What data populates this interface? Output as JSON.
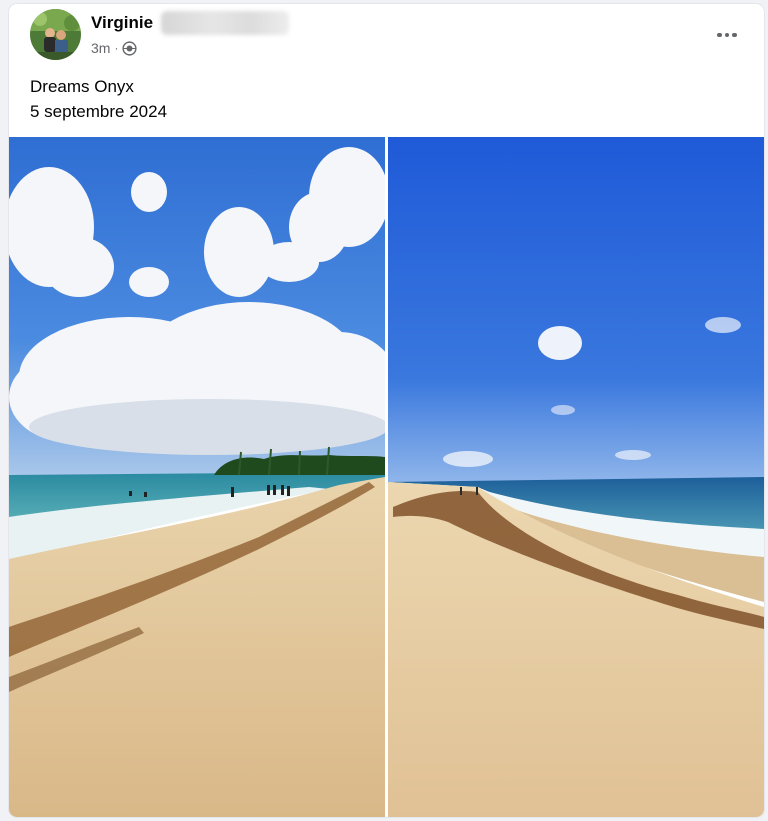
{
  "post": {
    "author_name": "Virginie",
    "timestamp": "3m",
    "separator": "·",
    "privacy_icon": "globe-icon",
    "menu_icon": "more-options-icon",
    "caption_lines": [
      "Dreams Onyx",
      "5 septembre 2024"
    ]
  },
  "photos": [
    {
      "name": "beach-photo-left",
      "icon": "image"
    },
    {
      "name": "beach-photo-right",
      "icon": "image"
    }
  ],
  "colors": {
    "text_primary": "#050505",
    "text_secondary": "#65676b",
    "card_bg": "#ffffff",
    "page_bg": "#f0f2f5"
  }
}
